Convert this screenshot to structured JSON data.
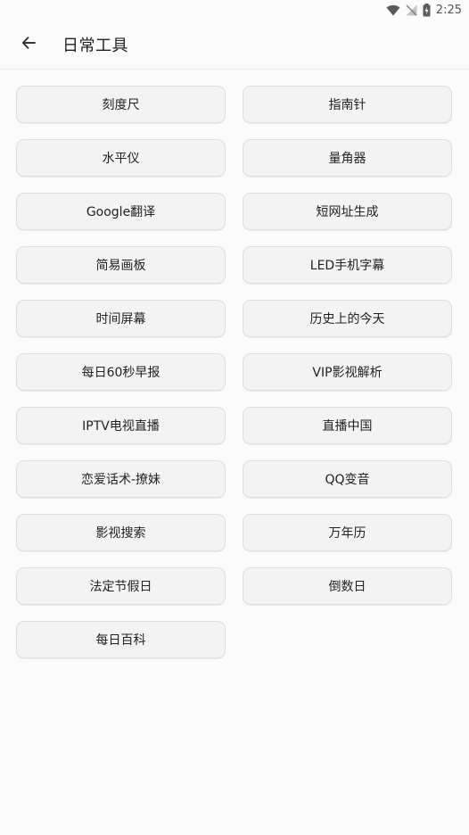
{
  "status_bar": {
    "time": "2:25",
    "icons": [
      "wifi-icon",
      "signal-off-icon",
      "battery-charging-icon"
    ]
  },
  "app_bar": {
    "back_icon": "arrow-left-icon",
    "title": "日常工具"
  },
  "tools": [
    {
      "label": "刻度尺"
    },
    {
      "label": "指南针"
    },
    {
      "label": "水平仪"
    },
    {
      "label": "量角器"
    },
    {
      "label": "Google翻译"
    },
    {
      "label": "短网址生成"
    },
    {
      "label": "简易画板"
    },
    {
      "label": "LED手机字幕"
    },
    {
      "label": "时间屏幕"
    },
    {
      "label": "历史上的今天"
    },
    {
      "label": "每日60秒早报"
    },
    {
      "label": "VIP影视解析"
    },
    {
      "label": "IPTV电视直播"
    },
    {
      "label": "直播中国"
    },
    {
      "label": "恋爱话术-撩妹"
    },
    {
      "label": "QQ变音"
    },
    {
      "label": "影视搜索"
    },
    {
      "label": "万年历"
    },
    {
      "label": "法定节假日"
    },
    {
      "label": "倒数日"
    },
    {
      "label": "每日百科"
    }
  ]
}
